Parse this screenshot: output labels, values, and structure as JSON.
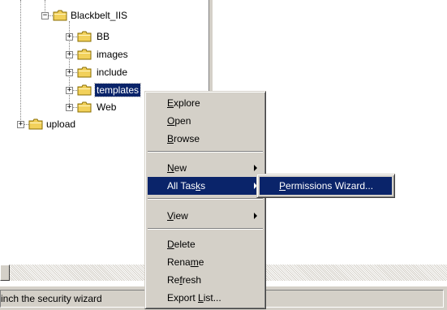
{
  "tree": {
    "items": [
      {
        "label": "Blackbelt_IIS",
        "expander": "−"
      },
      {
        "label": "BB",
        "expander": "+"
      },
      {
        "label": "images",
        "expander": "+"
      },
      {
        "label": "include",
        "expander": "+"
      },
      {
        "label": "templates",
        "expander": "+",
        "selected": true
      },
      {
        "label": "Web",
        "expander": "+"
      },
      {
        "label": "upload",
        "expander": "+"
      }
    ]
  },
  "context_menu": {
    "explore": {
      "pre": "",
      "key": "E",
      "post": "xplore"
    },
    "open": {
      "pre": "",
      "key": "O",
      "post": "pen"
    },
    "browse": {
      "pre": "",
      "key": "B",
      "post": "rowse"
    },
    "new": {
      "pre": "",
      "key": "N",
      "post": "ew"
    },
    "all_tasks": {
      "pre": "All Tas",
      "key": "k",
      "post": "s"
    },
    "view": {
      "pre": "",
      "key": "V",
      "post": "iew"
    },
    "delete": {
      "pre": "",
      "key": "D",
      "post": "elete"
    },
    "rename": {
      "pre": "Rena",
      "key": "m",
      "post": "e"
    },
    "refresh": {
      "pre": "Re",
      "key": "f",
      "post": "resh"
    },
    "export_list": {
      "pre": "Export ",
      "key": "L",
      "post": "ist..."
    }
  },
  "submenu": {
    "permissions_wizard": {
      "pre": "",
      "key": "P",
      "post": "ermissions Wizard..."
    }
  },
  "statusbar": {
    "text": "inch the security wizard"
  },
  "colors": {
    "highlight": "#0a246a",
    "face": "#d4d0c8",
    "folder": "#f2d15b"
  }
}
